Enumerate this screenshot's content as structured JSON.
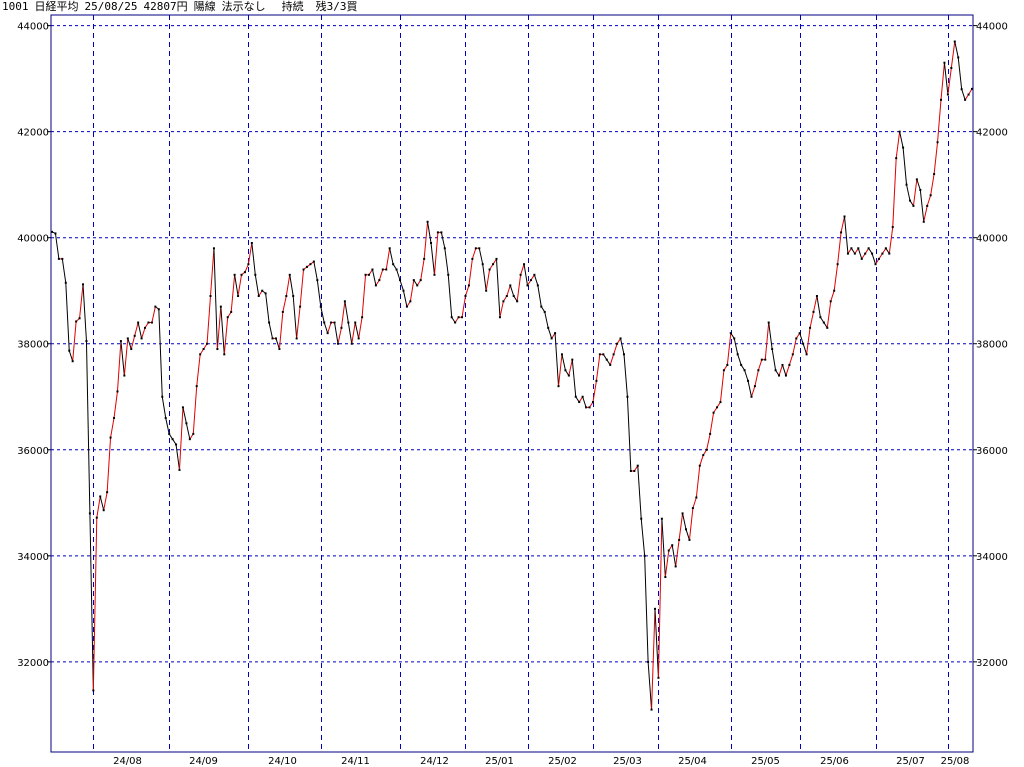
{
  "header": {
    "code": "1001",
    "name": "日経平均",
    "date": "25/08/25",
    "price": "42807円",
    "candle": "陽線",
    "signal": "法示なし",
    "position": "持続",
    "remaining": "残3/3買"
  },
  "colors": {
    "up_line": "#e00000",
    "down_line": "#000000",
    "grid": "#0000c0",
    "frame": "#000080"
  },
  "chart_data": {
    "type": "line",
    "title": "",
    "ylim": [
      30300,
      44200
    ],
    "yticks": [
      32000,
      34000,
      36000,
      38000,
      40000,
      42000,
      44000
    ],
    "ytick_labels": [
      "32000",
      "34000",
      "36000",
      "38000",
      "40000",
      "42000",
      "44000"
    ],
    "xtick_labels": [
      "24/08",
      "24/09",
      "24/10",
      "24/11",
      "24/12",
      "25/01",
      "25/02",
      "25/03",
      "25/04",
      "25/05",
      "25/06",
      "25/07",
      "25/08"
    ],
    "grid": true,
    "series": [
      {
        "values": [
          40110,
          40080,
          39600,
          39600,
          39150,
          37870,
          37670,
          38420,
          38480,
          39120,
          38050,
          34800,
          31460,
          34720,
          35120,
          34860,
          35200,
          36230,
          36600,
          37100,
          38050,
          37400,
          38100,
          37900,
          38150,
          38400,
          38100,
          38300,
          38400,
          38400,
          38700,
          38650,
          37000,
          36600,
          36300,
          36200,
          36100,
          35620,
          36800,
          36500,
          36200,
          36300,
          37200,
          37800,
          37900,
          38000,
          38900,
          39800,
          37900,
          38700,
          37800,
          38500,
          38600,
          39300,
          38900,
          39300,
          39350,
          39500,
          39900,
          39300,
          38900,
          39000,
          38950,
          38400,
          38100,
          38100,
          37900,
          38600,
          38900,
          39300,
          38900,
          38100,
          38700,
          39400,
          39450,
          39500,
          39550,
          39200,
          38700,
          38400,
          38200,
          38400,
          38400,
          38000,
          38300,
          38800,
          38400,
          38000,
          38400,
          38100,
          38500,
          39300,
          39300,
          39400,
          39100,
          39200,
          39400,
          39400,
          39800,
          39500,
          39400,
          39200,
          39000,
          38700,
          38800,
          39200,
          39100,
          39200,
          39600,
          40300,
          39900,
          39300,
          40100,
          40100,
          39800,
          39300,
          38500,
          38400,
          38500,
          38500,
          38900,
          39100,
          39600,
          39800,
          39800,
          39500,
          39000,
          39400,
          39500,
          39600,
          38500,
          38800,
          38900,
          39100,
          38900,
          38800,
          39300,
          39500,
          39100,
          39200,
          39300,
          39100,
          38700,
          38600,
          38300,
          38100,
          38200,
          37200,
          37800,
          37500,
          37400,
          37700,
          37000,
          36900,
          37000,
          36800,
          36800,
          36900,
          37300,
          37800,
          37800,
          37700,
          37600,
          37800,
          38000,
          38100,
          37800,
          37000,
          35600,
          35600,
          35700,
          34700,
          34000,
          32000,
          31100,
          33000,
          31700,
          34700,
          33600,
          34100,
          34200,
          33800,
          34300,
          34800,
          34500,
          34300,
          34900,
          35100,
          35700,
          35900,
          36000,
          36300,
          36700,
          36800,
          36900,
          37500,
          37600,
          38200,
          38100,
          37800,
          37600,
          37500,
          37300,
          37000,
          37200,
          37500,
          37700,
          37700,
          38400,
          37900,
          37500,
          37400,
          37600,
          37400,
          37600,
          37800,
          38100,
          38200,
          38000,
          37800,
          38300,
          38600,
          38900,
          38500,
          38400,
          38300,
          38800,
          39000,
          39500,
          40100,
          40400,
          39700,
          39800,
          39700,
          39800,
          39600,
          39700,
          39800,
          39700,
          39500,
          39600,
          39700,
          39800,
          39700,
          40200,
          41500,
          42000,
          41700,
          41000,
          40700,
          40600,
          41100,
          40900,
          40300,
          40600,
          40800,
          41200,
          41800,
          42600,
          43300,
          42700,
          43200,
          43700,
          43400,
          42800,
          42600,
          42700,
          42807
        ]
      }
    ]
  }
}
